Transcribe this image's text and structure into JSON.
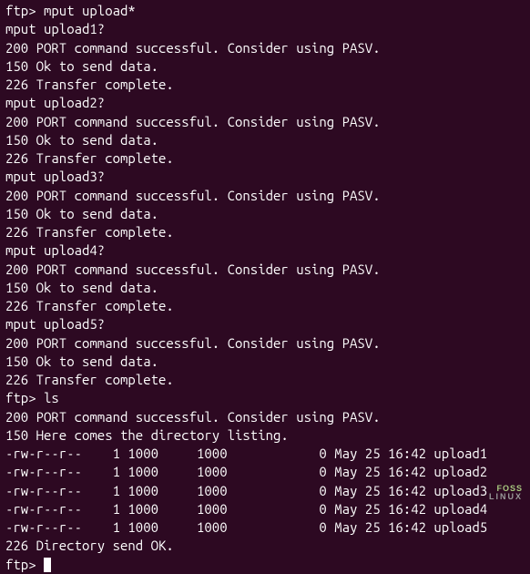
{
  "prompt": "ftp> ",
  "commands": {
    "mput": "mput upload*",
    "ls": "ls"
  },
  "upload_block": {
    "confirm_prefix": "mput upload",
    "confirm_suffix": "?",
    "line1": "200 PORT command successful. Consider using PASV.",
    "line2": "150 Ok to send data.",
    "line3": "226 Transfer complete."
  },
  "upload_count": 5,
  "ls_header": {
    "line1": "200 PORT command successful. Consider using PASV.",
    "line2": "150 Here comes the directory listing."
  },
  "listing": [
    {
      "perm": "-rw-r--r--",
      "links": "1",
      "owner": "1000",
      "group": "1000",
      "size": "0",
      "date": "May 25 16:42",
      "name": "upload1"
    },
    {
      "perm": "-rw-r--r--",
      "links": "1",
      "owner": "1000",
      "group": "1000",
      "size": "0",
      "date": "May 25 16:42",
      "name": "upload2"
    },
    {
      "perm": "-rw-r--r--",
      "links": "1",
      "owner": "1000",
      "group": "1000",
      "size": "0",
      "date": "May 25 16:42",
      "name": "upload3"
    },
    {
      "perm": "-rw-r--r--",
      "links": "1",
      "owner": "1000",
      "group": "1000",
      "size": "0",
      "date": "May 25 16:42",
      "name": "upload4"
    },
    {
      "perm": "-rw-r--r--",
      "links": "1",
      "owner": "1000",
      "group": "1000",
      "size": "0",
      "date": "May 25 16:42",
      "name": "upload5"
    }
  ],
  "ls_footer": "226 Directory send OK.",
  "watermark": {
    "top": "FOSS",
    "bot": "LINUX"
  }
}
